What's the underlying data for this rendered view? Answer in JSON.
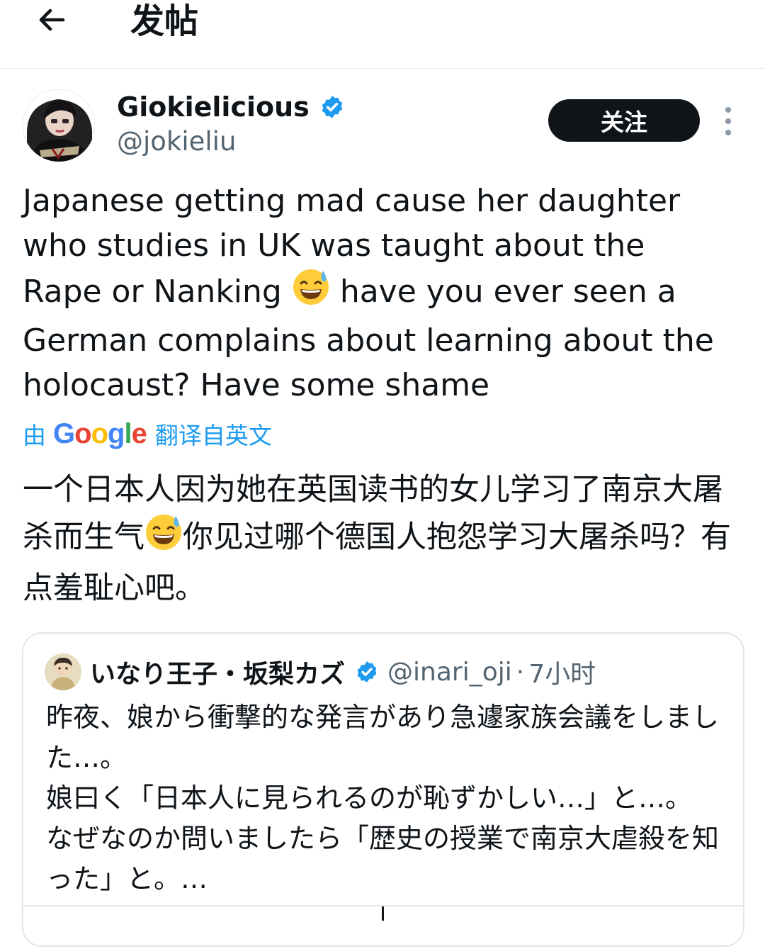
{
  "header": {
    "title": "发帖"
  },
  "tweet": {
    "author": {
      "display_name": "Giokielicious",
      "handle": "@jokieliu",
      "verified": true
    },
    "follow_label": "关注",
    "text_before_emoji": "Japanese getting mad cause her daughter\nwho studies in UK was taught about the\nRape or Nanking ",
    "text_after_emoji": " have you ever seen a\nGerman complains about learning about the\nholocaust? Have some shame",
    "translation": {
      "prefix": "由",
      "provider": "Google",
      "suffix": "翻译自英文",
      "text_before_emoji": "一个日本人因为她在英国读书的女儿学习了南京大屠杀而生气",
      "text_after_emoji": "你见过哪个德国人抱怨学习大屠杀吗？有点羞耻心吧。"
    },
    "emoji": "grinning-face-with-sweat"
  },
  "quote": {
    "author": {
      "display_name": "いなり王子・坂梨カズ",
      "handle": "@inari_oji",
      "verified": true
    },
    "separator": "·",
    "time": "7小时",
    "text": "昨夜、娘から衝撃的な発言があり急遽家族会議をしました…。\n娘曰く「日本人に見られるのが恥ずかしい…」と…。\nなぜなのか問いましたら「歴史の授業で南京大虐殺を知った」と。…"
  },
  "colors": {
    "accent": "#1d9bf0",
    "text": "#0f1419",
    "secondary_text": "#536471",
    "follow_button_bg": "#0f1419",
    "border": "#e1e6ea"
  },
  "icons": {
    "back": "arrow-left-icon",
    "verified": "verified-badge-icon",
    "more": "more-vertical-icon"
  }
}
